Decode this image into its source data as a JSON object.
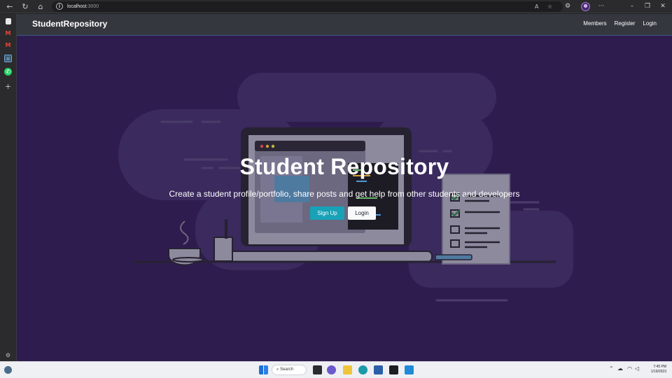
{
  "browser": {
    "url_host": "localhost",
    "url_port": ":3000"
  },
  "navbar": {
    "brand": "StudentRepository",
    "links": [
      "Members",
      "Register",
      "Login"
    ]
  },
  "hero": {
    "title": "Student Repository",
    "subtitle": "Create a student profile/portfolio, share posts and get help from other students and developers",
    "signup_label": "Sign Up",
    "login_label": "Login"
  },
  "taskbar": {
    "search_label": "Search",
    "time": "7:45 PM",
    "date": "1/19/2023"
  },
  "colors": {
    "page_bg": "#2f1c4f",
    "navbar_bg": "#34373d",
    "signup_bg": "#17a2b8",
    "login_bg": "#f8f9fa"
  }
}
